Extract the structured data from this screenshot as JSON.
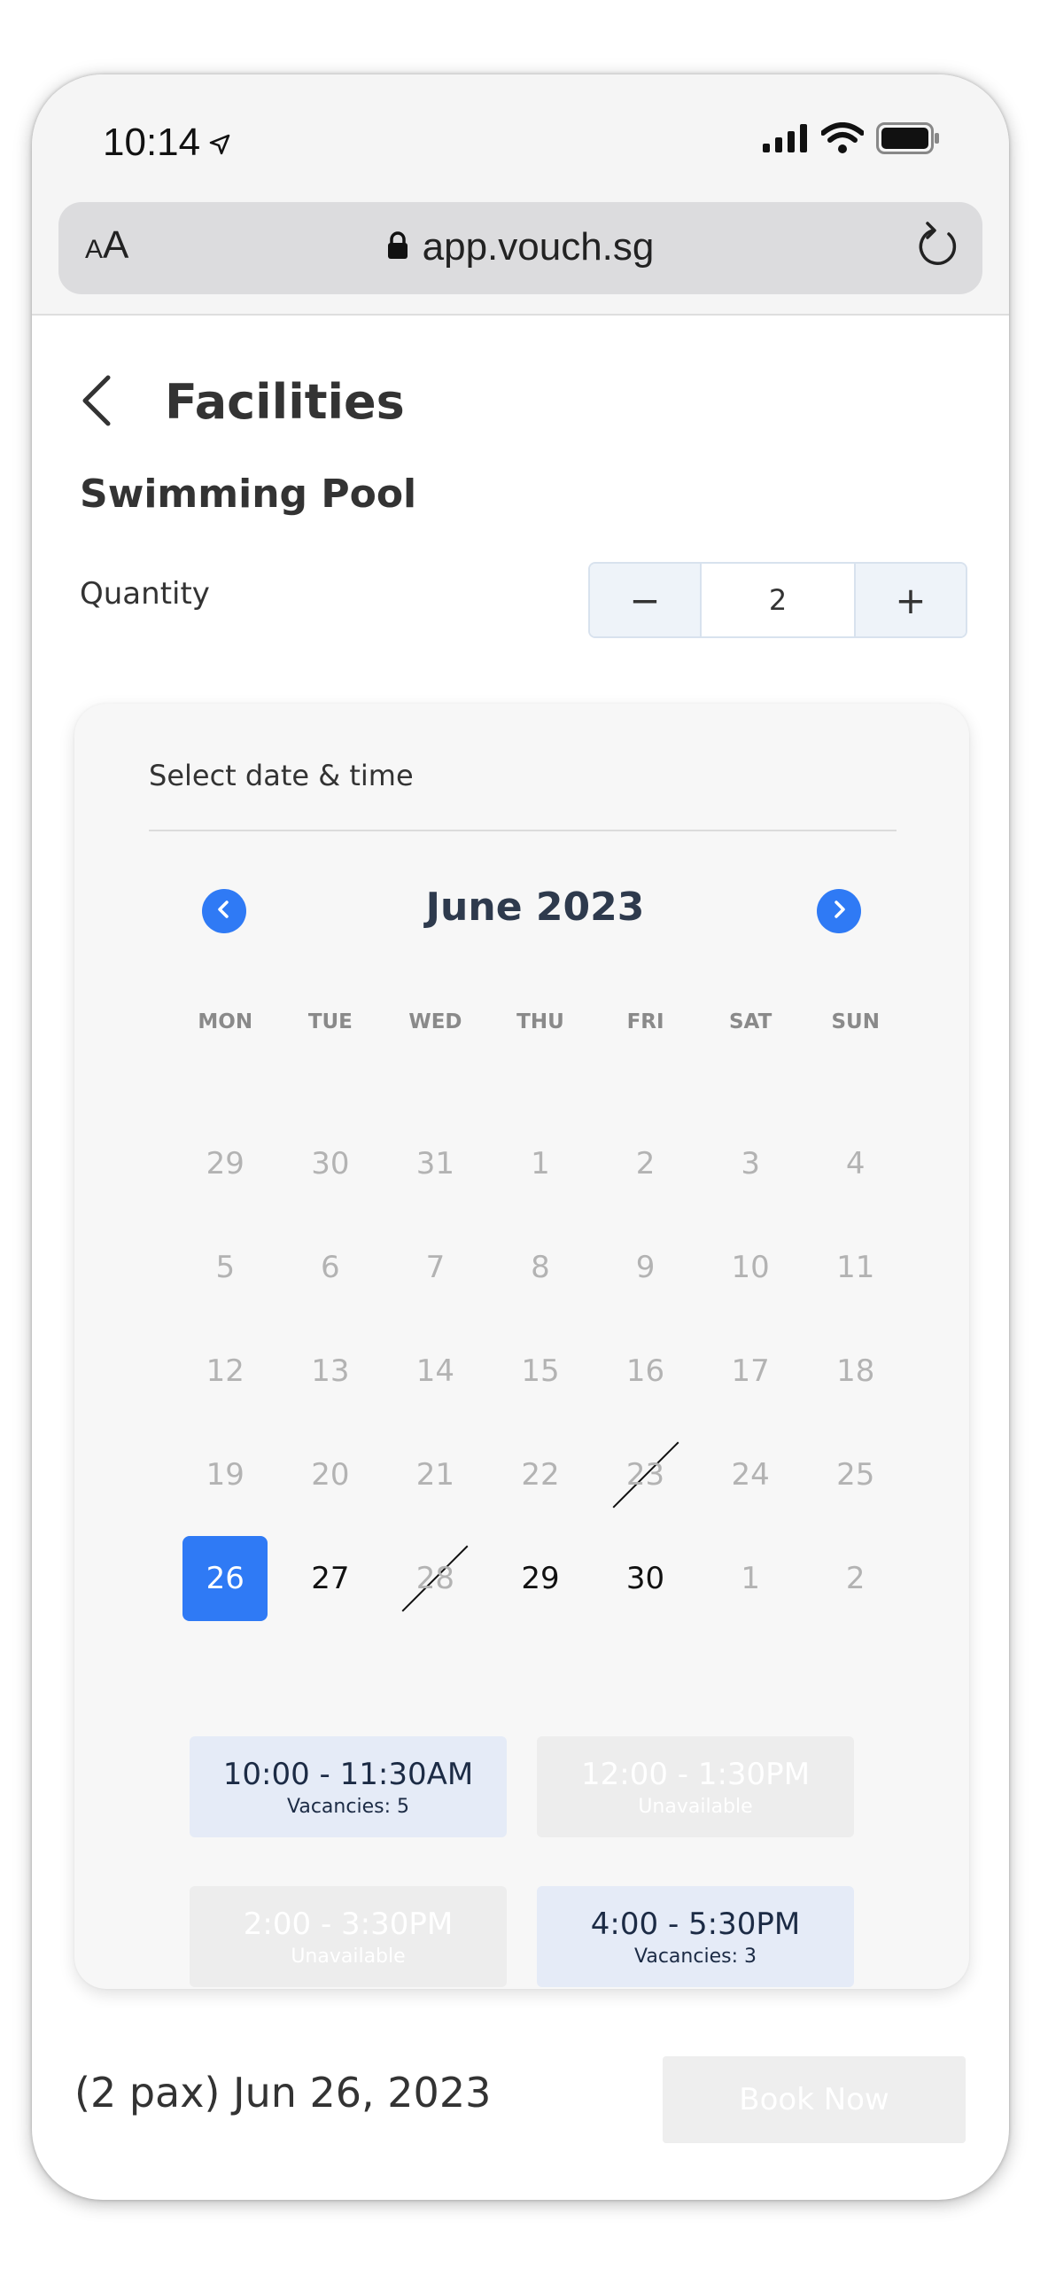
{
  "status_bar": {
    "time": "10:14",
    "icons": [
      "location-arrow-icon",
      "signal-icon",
      "wifi-icon",
      "battery-icon"
    ]
  },
  "browser": {
    "text_size_label_small": "A",
    "text_size_label_big": "A",
    "url": "app.vouch.sg",
    "icons": [
      "lock-icon",
      "reload-icon"
    ]
  },
  "header": {
    "title": "Facilities",
    "back_icon": "chevron-left-icon"
  },
  "facility": {
    "name": "Swimming Pool",
    "quantity_label": "Quantity",
    "decrement_label": "−",
    "increment_label": "+",
    "quantity_value": "2"
  },
  "calendar": {
    "heading": "Select date & time",
    "month_label": "June 2023",
    "weekdays": [
      "MON",
      "TUE",
      "WED",
      "THU",
      "FRI",
      "SAT",
      "SUN"
    ],
    "days": [
      {
        "label": "29",
        "state": "muted"
      },
      {
        "label": "30",
        "state": "muted"
      },
      {
        "label": "31",
        "state": "muted"
      },
      {
        "label": "1",
        "state": "muted"
      },
      {
        "label": "2",
        "state": "muted"
      },
      {
        "label": "3",
        "state": "muted"
      },
      {
        "label": "4",
        "state": "muted"
      },
      {
        "label": "5",
        "state": "muted"
      },
      {
        "label": "6",
        "state": "muted"
      },
      {
        "label": "7",
        "state": "muted"
      },
      {
        "label": "8",
        "state": "muted"
      },
      {
        "label": "9",
        "state": "muted"
      },
      {
        "label": "10",
        "state": "muted"
      },
      {
        "label": "11",
        "state": "muted"
      },
      {
        "label": "12",
        "state": "muted"
      },
      {
        "label": "13",
        "state": "muted"
      },
      {
        "label": "14",
        "state": "muted"
      },
      {
        "label": "15",
        "state": "muted"
      },
      {
        "label": "16",
        "state": "muted"
      },
      {
        "label": "17",
        "state": "muted"
      },
      {
        "label": "18",
        "state": "muted"
      },
      {
        "label": "19",
        "state": "muted"
      },
      {
        "label": "20",
        "state": "muted"
      },
      {
        "label": "21",
        "state": "muted"
      },
      {
        "label": "22",
        "state": "muted"
      },
      {
        "label": "23",
        "state": "muted-struck"
      },
      {
        "label": "24",
        "state": "muted"
      },
      {
        "label": "25",
        "state": "muted"
      },
      {
        "label": "26",
        "state": "selected"
      },
      {
        "label": "27",
        "state": "active"
      },
      {
        "label": "28",
        "state": "muted-struck"
      },
      {
        "label": "29",
        "state": "active"
      },
      {
        "label": "30",
        "state": "active"
      },
      {
        "label": "1",
        "state": "muted"
      },
      {
        "label": "2",
        "state": "muted"
      }
    ],
    "time_slots": [
      {
        "time": "10:00 - 11:30AM",
        "info": "Vacancies: 5",
        "available": true
      },
      {
        "time": "12:00 - 1:30PM",
        "info": "Unavailable",
        "available": false
      },
      {
        "time": "2:00 - 3:30PM",
        "info": "Unavailable",
        "available": false
      },
      {
        "time": "4:00 - 5:30PM",
        "info": "Vacancies: 3",
        "available": true
      }
    ]
  },
  "footer": {
    "summary": "(2 pax) Jun 26, 2023",
    "book_label": "Book Now"
  },
  "colors": {
    "accent": "#2f7af5",
    "slot_available": "#e5ebf7",
    "slot_unavailable": "#ededed"
  }
}
